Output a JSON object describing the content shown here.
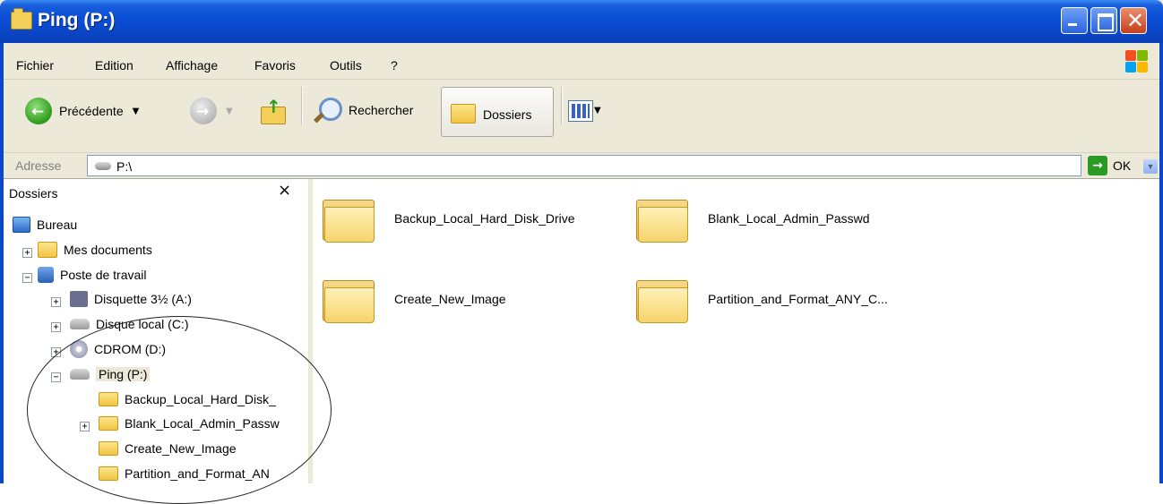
{
  "window": {
    "title": "Ping (P:)"
  },
  "menu": {
    "items": [
      "Fichier",
      "Edition",
      "Affichage",
      "Favoris",
      "Outils",
      "?"
    ]
  },
  "toolbar": {
    "back_label": "Précédente",
    "search_label": "Rechercher",
    "folders_label": "Dossiers"
  },
  "address": {
    "label": "Adresse",
    "value": "P:\\",
    "go_label": "OK"
  },
  "folders_pane": {
    "title": "Dossiers",
    "close_glyph": "×",
    "tree": [
      {
        "label": "Bureau",
        "icon": "desktop-icon"
      },
      {
        "label": "Mes documents",
        "icon": "my-documents-icon",
        "expander": "+"
      },
      {
        "label": "Poste de travail",
        "icon": "my-computer-icon",
        "expander": "−"
      },
      {
        "label": "Disquette 3½ (A:)",
        "icon": "floppy-drive-icon",
        "expander": "+"
      },
      {
        "label": "Disque local (C:)",
        "icon": "hard-drive-icon",
        "expander": "+"
      },
      {
        "label": "CDROM (D:)",
        "icon": "cdrom-drive-icon",
        "expander": "+"
      },
      {
        "label": "Ping (P:)",
        "icon": "network-drive-icon",
        "expander": "−",
        "selected": true
      },
      {
        "label": "Backup_Local_Hard_Disk_",
        "icon": "folder-icon"
      },
      {
        "label": "Blank_Local_Admin_Passw",
        "icon": "folder-icon",
        "expander": "+"
      },
      {
        "label": "Create_New_Image",
        "icon": "folder-icon"
      },
      {
        "label": "Partition_and_Format_AN",
        "icon": "folder-icon"
      }
    ]
  },
  "content": {
    "items": [
      {
        "label": "Backup_Local_Hard_Disk_Drive",
        "icon": "folder-icon"
      },
      {
        "label": "Blank_Local_Admin_Passwd",
        "icon": "folder-icon"
      },
      {
        "label": "Create_New_Image",
        "icon": "folder-icon"
      },
      {
        "label": "Partition_and_Format_ANY_C...",
        "icon": "folder-icon"
      }
    ]
  },
  "colors": {
    "titlebar": "#0a4ed6",
    "chrome": "#ece9d8",
    "close_button": "#c7401b",
    "folder": "#f1c544"
  }
}
